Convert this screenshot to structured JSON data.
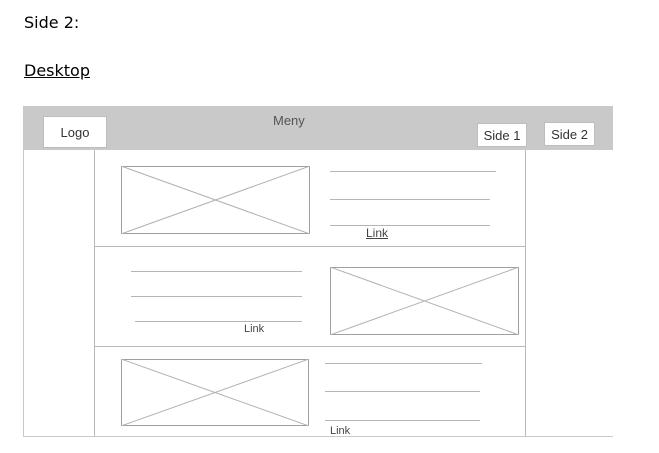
{
  "document": {
    "heading": "Side 2:",
    "subheading": "Desktop"
  },
  "header": {
    "logo": "Logo",
    "menu": "Meny",
    "nav": [
      "Side 1",
      "Side 2"
    ]
  },
  "rows": [
    {
      "link": "Link",
      "image_side": "left"
    },
    {
      "link": "Link",
      "image_side": "right"
    },
    {
      "link": "Link",
      "image_side": "left"
    }
  ]
}
